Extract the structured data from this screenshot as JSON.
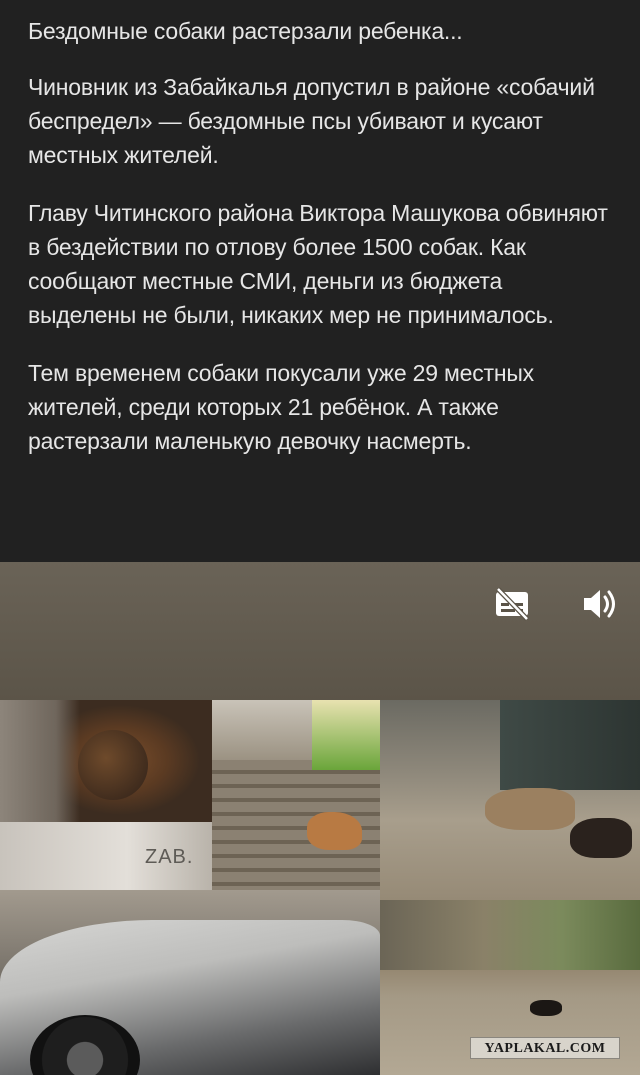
{
  "post": {
    "title": "Бездомные собаки растерзали ребенка...",
    "paragraphs": [
      "Чиновник из Забайкалья допустил в районе «собачий беспредел» — бездомные псы убивают и кусают местных жителей.",
      "Главу Читинского района Виктора Машукова обвиняют в бездействии по отлову более 1500 собак. Как сообщают местные СМИ, деньги из бюджета выделены не были, никаких мер не принималось.",
      "Тем временем собаки покусали уже 29 местных жителей, среди которых 21 ребёнок. А также растерзали маленькую девочку насмерть."
    ]
  },
  "video": {
    "icons": {
      "captions": "captions-off-icon",
      "volume": "volume-icon"
    },
    "frame_text": "ZAB.",
    "watermark": "YAPLAKAL.COM"
  },
  "colors": {
    "background": "#212121",
    "text": "#e6e6e6",
    "video_bg": "#5a5348"
  }
}
